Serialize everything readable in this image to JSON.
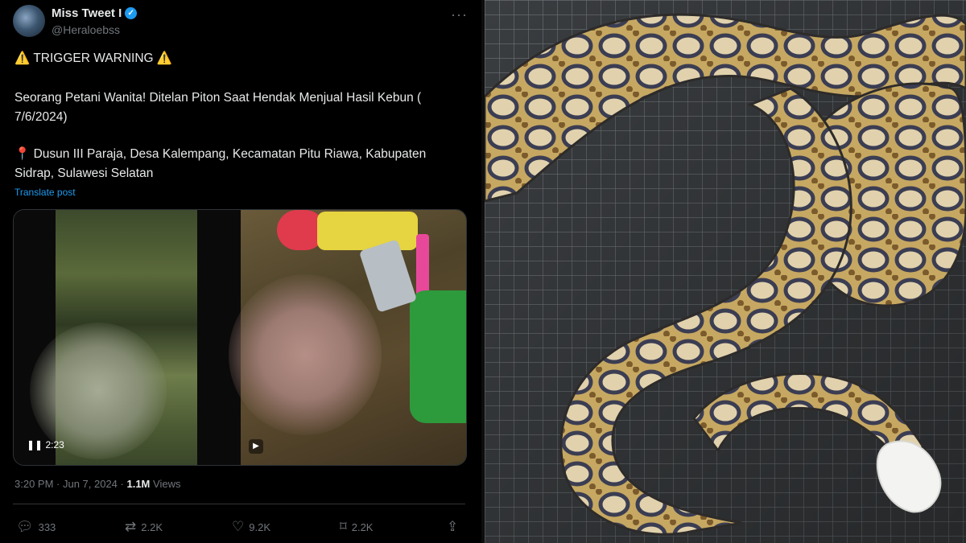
{
  "tweet": {
    "author_name": "Miss Tweet I",
    "handle": "@Heraloebss",
    "trigger_warning": "⚠️ TRIGGER WARNING ⚠️",
    "headline": "Seorang Petani Wanita! Ditelan Piton Saat Hendak Menjual Hasil Kebun (",
    "headline_date": "7/6/2024)",
    "location_line1": "📍 Dusun III Paraja, Desa Kalempang, Kecamatan Pitu Riawa, Kabupaten",
    "location_line2": "Sidrap, Sulawesi Selatan",
    "translate_label": "Translate post",
    "video_time": "2:23",
    "timestamp": "3:20 PM · Jun 7, 2024 ·",
    "views_count": "1.1M",
    "views_label": "Views",
    "actions": {
      "replies": "333",
      "reposts": "2.2K",
      "likes": "9.2K",
      "bookmarks": "2.2K"
    },
    "icons": {
      "verified": "verified-badge-icon",
      "more": "more-icon",
      "reply": "reply-icon",
      "repost": "repost-icon",
      "like": "heart-icon",
      "bookmark": "bookmark-icon",
      "share": "share-icon"
    }
  },
  "colors": {
    "background": "#000000",
    "text": "#e7e9ea",
    "muted": "#71767b",
    "link": "#1d9bf0"
  }
}
